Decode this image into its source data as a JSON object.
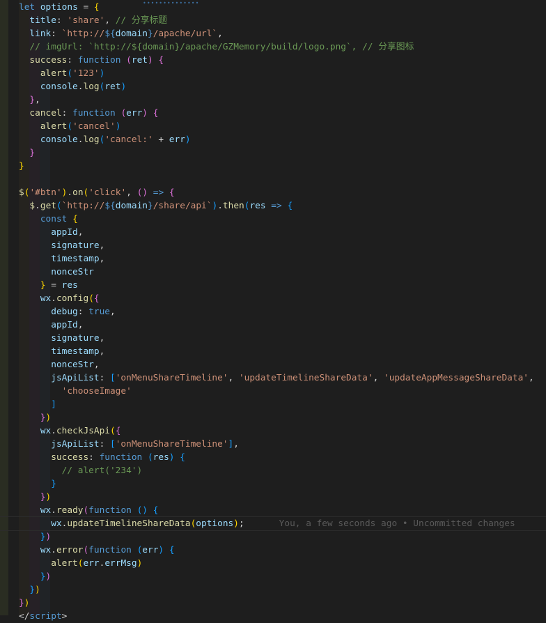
{
  "editor": {
    "blame": "You, a few seconds ago • Uncommitted changes",
    "current_line": 40,
    "lines": [
      [
        [
          "k",
          "let"
        ],
        [
          "t",
          " "
        ],
        [
          "p",
          "options"
        ],
        [
          "t",
          " = "
        ],
        [
          "b1",
          "{"
        ]
      ],
      [
        [
          "t",
          "  "
        ],
        [
          "p",
          "title"
        ],
        [
          "t",
          ": "
        ],
        [
          "s",
          "'share'"
        ],
        [
          "t",
          ", "
        ],
        [
          "c",
          "// 分享标题"
        ]
      ],
      [
        [
          "t",
          "  "
        ],
        [
          "p",
          "link"
        ],
        [
          "t",
          ": "
        ],
        [
          "s",
          "`http://"
        ],
        [
          "n",
          "${"
        ],
        [
          "p",
          "domain"
        ],
        [
          "n",
          "}"
        ],
        [
          "s",
          "/apache/url`"
        ],
        [
          "t",
          ","
        ]
      ],
      [
        [
          "t",
          "  "
        ],
        [
          "c",
          "// imgUrl: `http://${domain}/apache/GZMemory/build/logo.png`, // 分享图标"
        ]
      ],
      [
        [
          "t",
          "  "
        ],
        [
          "f",
          "success"
        ],
        [
          "t",
          ": "
        ],
        [
          "k",
          "function"
        ],
        [
          "t",
          " "
        ],
        [
          "b2",
          "("
        ],
        [
          "p",
          "ret"
        ],
        [
          "b2",
          ")"
        ],
        [
          "t",
          " "
        ],
        [
          "b2",
          "{"
        ]
      ],
      [
        [
          "t",
          "    "
        ],
        [
          "f",
          "alert"
        ],
        [
          "b3",
          "("
        ],
        [
          "s",
          "'123'"
        ],
        [
          "b3",
          ")"
        ]
      ],
      [
        [
          "t",
          "    "
        ],
        [
          "p",
          "console"
        ],
        [
          "t",
          "."
        ],
        [
          "f",
          "log"
        ],
        [
          "b3",
          "("
        ],
        [
          "p",
          "ret"
        ],
        [
          "b3",
          ")"
        ]
      ],
      [
        [
          "t",
          "  "
        ],
        [
          "b2",
          "}"
        ],
        [
          "t",
          ","
        ]
      ],
      [
        [
          "t",
          "  "
        ],
        [
          "f",
          "cancel"
        ],
        [
          "t",
          ": "
        ],
        [
          "k",
          "function"
        ],
        [
          "t",
          " "
        ],
        [
          "b2",
          "("
        ],
        [
          "p",
          "err"
        ],
        [
          "b2",
          ")"
        ],
        [
          "t",
          " "
        ],
        [
          "b2",
          "{"
        ]
      ],
      [
        [
          "t",
          "    "
        ],
        [
          "f",
          "alert"
        ],
        [
          "b3",
          "("
        ],
        [
          "s",
          "'cancel'"
        ],
        [
          "b3",
          ")"
        ]
      ],
      [
        [
          "t",
          "    "
        ],
        [
          "p",
          "console"
        ],
        [
          "t",
          "."
        ],
        [
          "f",
          "log"
        ],
        [
          "b3",
          "("
        ],
        [
          "s",
          "'cancel:'"
        ],
        [
          "t",
          " + "
        ],
        [
          "p",
          "err"
        ],
        [
          "b3",
          ")"
        ]
      ],
      [
        [
          "t",
          "  "
        ],
        [
          "b2",
          "}"
        ]
      ],
      [
        [
          "b1",
          "}"
        ]
      ],
      [],
      [
        [
          "f",
          "$"
        ],
        [
          "b1",
          "("
        ],
        [
          "s",
          "'#btn'"
        ],
        [
          "b1",
          ")"
        ],
        [
          "t",
          "."
        ],
        [
          "f",
          "on"
        ],
        [
          "b1",
          "("
        ],
        [
          "s",
          "'click'"
        ],
        [
          "t",
          ", "
        ],
        [
          "b2",
          "()"
        ],
        [
          "t",
          " "
        ],
        [
          "k",
          "=>"
        ],
        [
          "t",
          " "
        ],
        [
          "b2",
          "{"
        ]
      ],
      [
        [
          "t",
          "  "
        ],
        [
          "f",
          "$"
        ],
        [
          "t",
          "."
        ],
        [
          "f",
          "get"
        ],
        [
          "b3",
          "("
        ],
        [
          "s",
          "`http://"
        ],
        [
          "n",
          "${"
        ],
        [
          "p",
          "domain"
        ],
        [
          "n",
          "}"
        ],
        [
          "s",
          "/share/api`"
        ],
        [
          "b3",
          ")"
        ],
        [
          "t",
          "."
        ],
        [
          "f",
          "then"
        ],
        [
          "b3",
          "("
        ],
        [
          "p",
          "res"
        ],
        [
          "t",
          " "
        ],
        [
          "k",
          "=>"
        ],
        [
          "t",
          " "
        ],
        [
          "b3",
          "{"
        ]
      ],
      [
        [
          "t",
          "    "
        ],
        [
          "k",
          "const"
        ],
        [
          "t",
          " "
        ],
        [
          "b1",
          "{"
        ]
      ],
      [
        [
          "t",
          "      "
        ],
        [
          "p",
          "appId"
        ],
        [
          "t",
          ","
        ]
      ],
      [
        [
          "t",
          "      "
        ],
        [
          "p",
          "signature"
        ],
        [
          "t",
          ","
        ]
      ],
      [
        [
          "t",
          "      "
        ],
        [
          "p",
          "timestamp"
        ],
        [
          "t",
          ","
        ]
      ],
      [
        [
          "t",
          "      "
        ],
        [
          "p",
          "nonceStr"
        ]
      ],
      [
        [
          "t",
          "    "
        ],
        [
          "b1",
          "}"
        ],
        [
          "t",
          " = "
        ],
        [
          "p",
          "res"
        ]
      ],
      [
        [
          "t",
          "    "
        ],
        [
          "p",
          "wx"
        ],
        [
          "t",
          "."
        ],
        [
          "f",
          "config"
        ],
        [
          "b1",
          "("
        ],
        [
          "b2",
          "{"
        ]
      ],
      [
        [
          "t",
          "      "
        ],
        [
          "p",
          "debug"
        ],
        [
          "t",
          ": "
        ],
        [
          "k",
          "true"
        ],
        [
          "t",
          ","
        ]
      ],
      [
        [
          "t",
          "      "
        ],
        [
          "p",
          "appId"
        ],
        [
          "t",
          ","
        ]
      ],
      [
        [
          "t",
          "      "
        ],
        [
          "p",
          "signature"
        ],
        [
          "t",
          ","
        ]
      ],
      [
        [
          "t",
          "      "
        ],
        [
          "p",
          "timestamp"
        ],
        [
          "t",
          ","
        ]
      ],
      [
        [
          "t",
          "      "
        ],
        [
          "p",
          "nonceStr"
        ],
        [
          "t",
          ","
        ]
      ],
      [
        [
          "t",
          "      "
        ],
        [
          "p",
          "jsApiList"
        ],
        [
          "t",
          ": "
        ],
        [
          "b3",
          "["
        ],
        [
          "s",
          "'onMenuShareTimeline'"
        ],
        [
          "t",
          ", "
        ],
        [
          "s",
          "'updateTimelineShareData'"
        ],
        [
          "t",
          ", "
        ],
        [
          "s",
          "'updateAppMessageShareData'"
        ],
        [
          "t",
          ","
        ]
      ],
      [
        [
          "t",
          "        "
        ],
        [
          "s",
          "'chooseImage'"
        ]
      ],
      [
        [
          "t",
          "      "
        ],
        [
          "b3",
          "]"
        ]
      ],
      [
        [
          "t",
          "    "
        ],
        [
          "b2",
          "}"
        ],
        [
          "b1",
          ")"
        ]
      ],
      [
        [
          "t",
          "    "
        ],
        [
          "p",
          "wx"
        ],
        [
          "t",
          "."
        ],
        [
          "f",
          "checkJsApi"
        ],
        [
          "b1",
          "("
        ],
        [
          "b2",
          "{"
        ]
      ],
      [
        [
          "t",
          "      "
        ],
        [
          "p",
          "jsApiList"
        ],
        [
          "t",
          ": "
        ],
        [
          "b3",
          "["
        ],
        [
          "s",
          "'onMenuShareTimeline'"
        ],
        [
          "b3",
          "]"
        ],
        [
          "t",
          ","
        ]
      ],
      [
        [
          "t",
          "      "
        ],
        [
          "f",
          "success"
        ],
        [
          "t",
          ": "
        ],
        [
          "k",
          "function"
        ],
        [
          "t",
          " "
        ],
        [
          "b3",
          "("
        ],
        [
          "p",
          "res"
        ],
        [
          "b3",
          ")"
        ],
        [
          "t",
          " "
        ],
        [
          "b3",
          "{"
        ]
      ],
      [
        [
          "t",
          "        "
        ],
        [
          "c",
          "// alert('234')"
        ]
      ],
      [
        [
          "t",
          "      "
        ],
        [
          "b3",
          "}"
        ]
      ],
      [
        [
          "t",
          "    "
        ],
        [
          "b2",
          "}"
        ],
        [
          "b1",
          ")"
        ]
      ],
      [
        [
          "t",
          "    "
        ],
        [
          "p",
          "wx"
        ],
        [
          "t",
          "."
        ],
        [
          "f",
          "ready"
        ],
        [
          "b2",
          "("
        ],
        [
          "k",
          "function"
        ],
        [
          "t",
          " "
        ],
        [
          "b3",
          "()"
        ],
        [
          "t",
          " "
        ],
        [
          "b3",
          "{"
        ]
      ],
      [
        [
          "t",
          "      "
        ],
        [
          "p",
          "wx"
        ],
        [
          "t",
          "."
        ],
        [
          "f",
          "updateTimelineShareData"
        ],
        [
          "b1",
          "("
        ],
        [
          "p",
          "options"
        ],
        [
          "b1",
          ")"
        ],
        [
          "t",
          ";"
        ]
      ],
      [
        [
          "t",
          "    "
        ],
        [
          "b3",
          "}"
        ],
        [
          "b2",
          ")"
        ]
      ],
      [
        [
          "t",
          "    "
        ],
        [
          "p",
          "wx"
        ],
        [
          "t",
          "."
        ],
        [
          "f",
          "error"
        ],
        [
          "b2",
          "("
        ],
        [
          "k",
          "function"
        ],
        [
          "t",
          " "
        ],
        [
          "b3",
          "("
        ],
        [
          "p",
          "err"
        ],
        [
          "b3",
          ")"
        ],
        [
          "t",
          " "
        ],
        [
          "b3",
          "{"
        ]
      ],
      [
        [
          "t",
          "      "
        ],
        [
          "f",
          "alert"
        ],
        [
          "b1",
          "("
        ],
        [
          "p",
          "err"
        ],
        [
          "t",
          "."
        ],
        [
          "p",
          "errMsg"
        ],
        [
          "b1",
          ")"
        ]
      ],
      [
        [
          "t",
          "    "
        ],
        [
          "b3",
          "}"
        ],
        [
          "b2",
          ")"
        ]
      ],
      [
        [
          "t",
          "  "
        ],
        [
          "b3",
          "}"
        ],
        [
          "b1",
          ")"
        ]
      ],
      [
        [
          "b2",
          "}"
        ],
        [
          "b1",
          ")"
        ]
      ],
      [
        [
          "t",
          "</"
        ],
        [
          "k",
          "script"
        ],
        [
          "t",
          ">"
        ]
      ]
    ]
  }
}
